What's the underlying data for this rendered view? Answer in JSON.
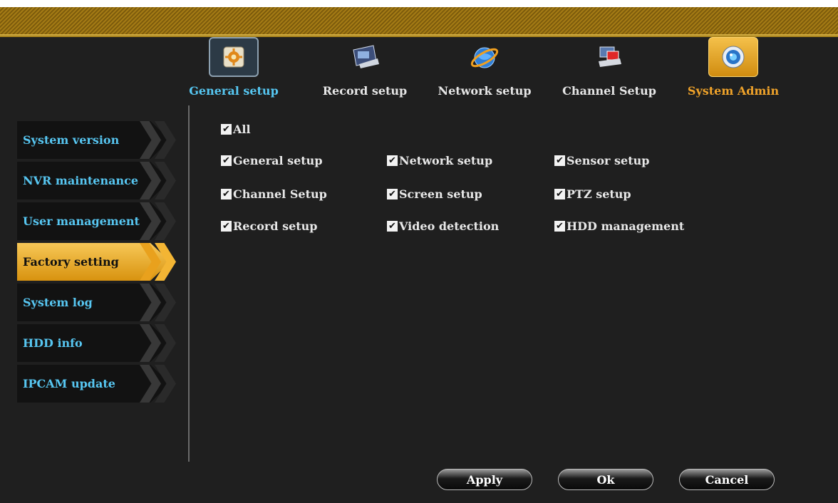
{
  "tabs": [
    {
      "label": "General setup",
      "icon": "settings-gear-icon"
    },
    {
      "label": "Record setup",
      "icon": "record-camera-icon"
    },
    {
      "label": "Network setup",
      "icon": "network-globe-icon"
    },
    {
      "label": "Channel Setup",
      "icon": "channel-icon"
    },
    {
      "label": "System Admin",
      "icon": "system-admin-icon"
    }
  ],
  "sidebar": {
    "items": [
      {
        "label": "System version"
      },
      {
        "label": "NVR maintenance"
      },
      {
        "label": "User management"
      },
      {
        "label": "Factory setting"
      },
      {
        "label": "System log"
      },
      {
        "label": "HDD info"
      },
      {
        "label": "IPCAM update"
      }
    ],
    "active": "Factory setting"
  },
  "factory": {
    "all_label": "All",
    "options": [
      {
        "label": "General setup",
        "checked": true
      },
      {
        "label": "Network setup",
        "checked": true
      },
      {
        "label": "Sensor setup",
        "checked": true
      },
      {
        "label": "Channel Setup",
        "checked": true
      },
      {
        "label": "Screen setup",
        "checked": true
      },
      {
        "label": "PTZ setup",
        "checked": true
      },
      {
        "label": "Record setup",
        "checked": true
      },
      {
        "label": "Video detection",
        "checked": true
      },
      {
        "label": "HDD management",
        "checked": true
      }
    ]
  },
  "buttons": {
    "apply": "Apply",
    "ok": "Ok",
    "cancel": "Cancel"
  },
  "colors": {
    "accent_blue": "#56c7f2",
    "accent_orange": "#f0a32a"
  }
}
